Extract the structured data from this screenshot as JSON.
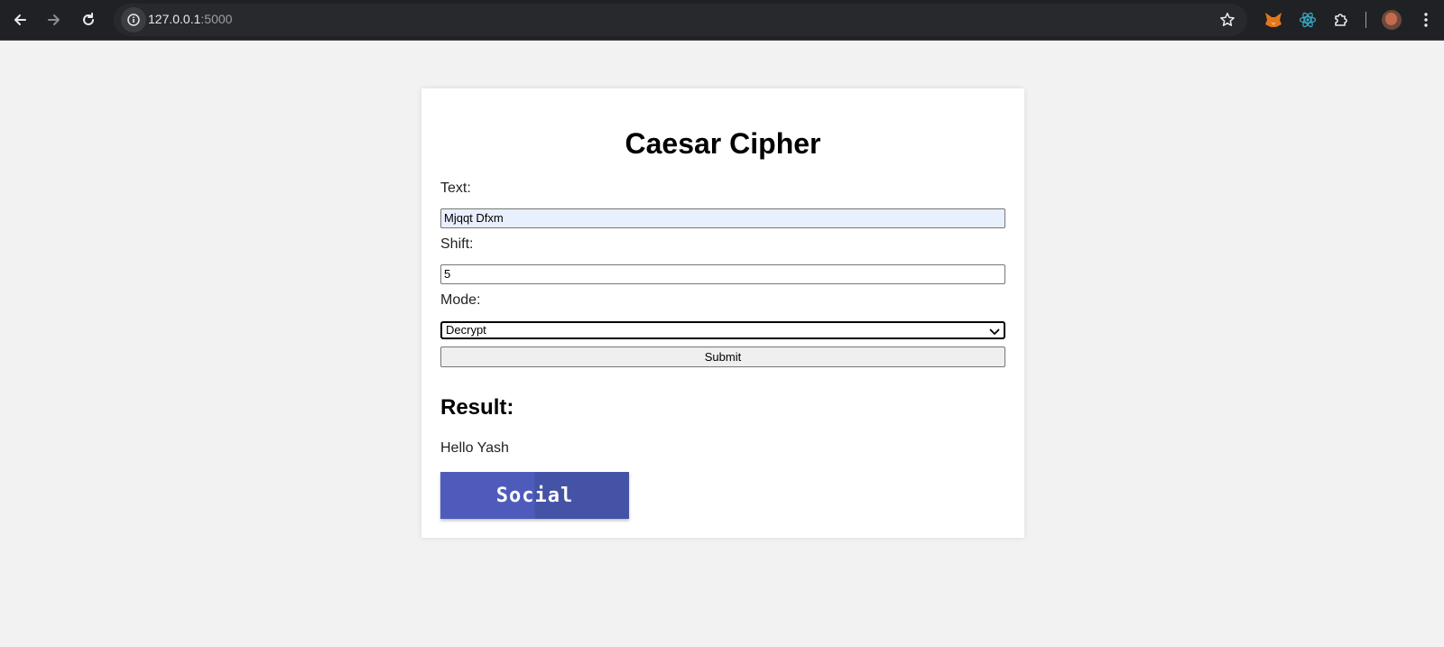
{
  "browser": {
    "url_host": "127.0.0.1",
    "url_port": ":5000",
    "icons": [
      "back-arrow-icon",
      "forward-arrow-icon",
      "reload-icon",
      "info-icon",
      "star-icon",
      "fox-extension-icon",
      "react-extension-icon",
      "puzzle-extensions-icon",
      "profile-avatar",
      "kebab-menu-icon"
    ]
  },
  "page": {
    "title": "Caesar Cipher",
    "text_label": "Text:",
    "text_value": "Mjqqt Dfxm",
    "shift_label": "Shift:",
    "shift_value": "5",
    "mode_label": "Mode:",
    "mode_selected": "Decrypt",
    "submit_label": "Submit",
    "result_heading": "Result:",
    "result_text": "Hello Yash",
    "social_label": "Social"
  },
  "colors": {
    "page_bg": "#f2f2f2",
    "card_bg": "#ffffff",
    "chrome_bg": "#202124",
    "social_button": "#4f5bbb",
    "autofill_bg": "#e8f0fe"
  }
}
